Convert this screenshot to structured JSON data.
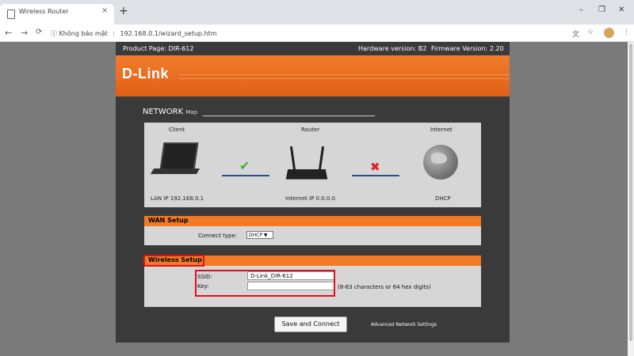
{
  "browser": {
    "tab_title": "Wireless Router",
    "tab_close": "×",
    "new_tab": "+",
    "window_controls": [
      "–",
      "❐",
      "✕"
    ],
    "nav": {
      "back": "←",
      "forward": "→",
      "reload": "C"
    },
    "security_label": "Không bảo mật",
    "url": "192.168.0.1/wizard_setup.htm",
    "toolbar_icons": [
      "translate-icon",
      "star-icon",
      "avatar",
      "menu-icon"
    ]
  },
  "router_page": {
    "product_page": "Product Page: DIR-612",
    "hardware_version": "Hardware version: B2",
    "firmware_version": "Firmware Version: 2.20",
    "logo": "D-Link",
    "network_title": "NETWORK",
    "network_subtitle": "Map",
    "map": {
      "client_label": "Client",
      "router_label": "Router",
      "internet_label": "Internet",
      "lan_ip": "LAN IP 192.168.0.1",
      "internet_ip": "Internet IP 0.0.0.0",
      "wan_type": "DHCP",
      "client_router_status": "connected",
      "router_internet_status": "disconnected"
    },
    "wan_setup": {
      "title": "WAN Setup",
      "connect_type_label": "Connect type:",
      "connect_type_value": "DHCP"
    },
    "wireless_setup": {
      "title": "Wireless Setup",
      "ssid_label": "SSID:",
      "ssid_value": "D-Link_DIR-612",
      "key_label": "Key:",
      "key_value": "",
      "key_hint": "(8-63 characters or 64 hex digits)"
    },
    "save_button": "Save and Connect",
    "advanced_link": "Advanced Network Settings"
  },
  "colors": {
    "accent_orange": "#f07a26",
    "highlight_red": "#e0101a",
    "panel_dark": "#3a3a3a"
  }
}
